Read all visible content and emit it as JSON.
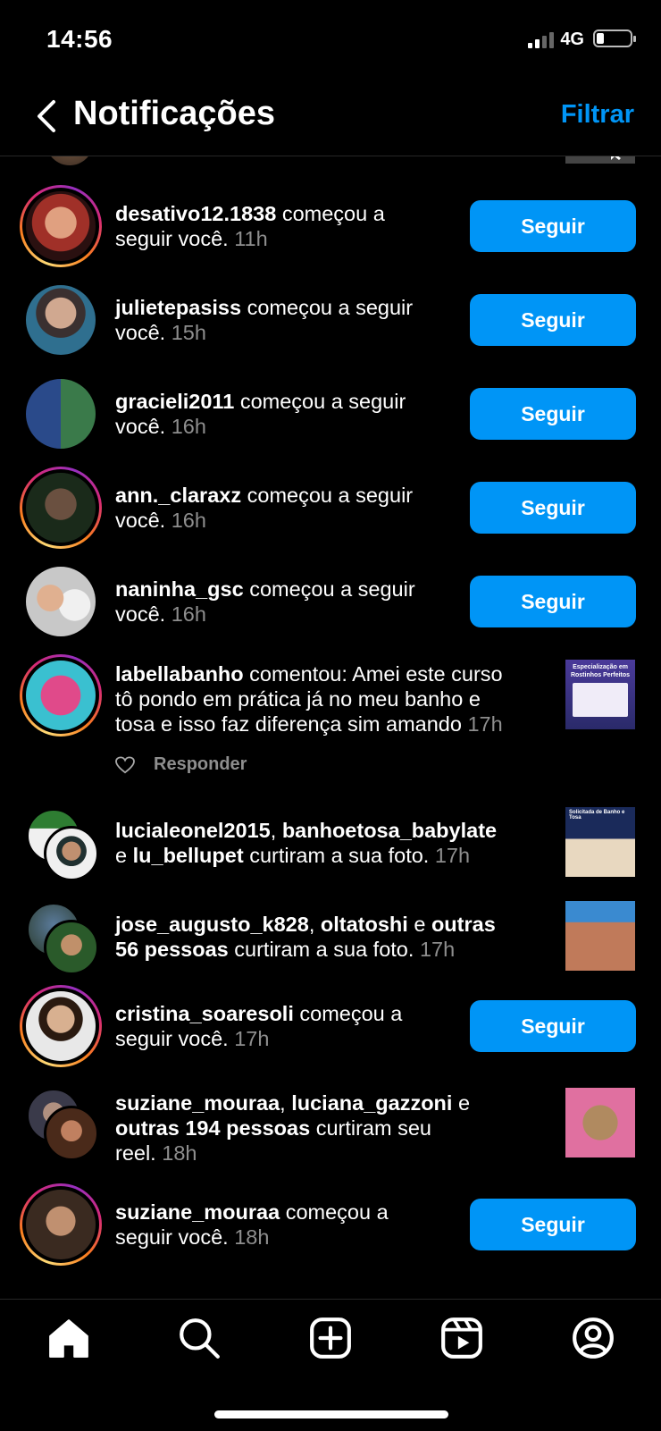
{
  "status_bar": {
    "time": "14:56",
    "network": "4G"
  },
  "header": {
    "title": "Notificações",
    "filter_label": "Filtrar"
  },
  "notifications": [
    {
      "user": "desativo12.1838",
      "action": "começou a",
      "action2": "seguir você.",
      "time": "11h",
      "button": "Seguir"
    },
    {
      "user": "julietepasiss",
      "action": "começou a seguir",
      "action2": "você.",
      "time": "15h",
      "button": "Seguir"
    },
    {
      "user": "gracieli2011",
      "action": "começou a seguir",
      "action2": "você.",
      "time": "16h",
      "button": "Seguir"
    },
    {
      "user": "ann._claraxz",
      "action": "começou a seguir",
      "action2": "você.",
      "time": "16h",
      "button": "Seguir"
    },
    {
      "user": "naninha_gsc",
      "action": "começou a seguir",
      "action2": "você.",
      "time": "16h",
      "button": "Seguir"
    },
    {
      "user": "labellabanho",
      "line1": "comentou: Amei este curso",
      "line2": "tô pondo em prática já no meu banho e",
      "line3": "tosa e isso faz diferença sim amando",
      "time": "17h",
      "reply": "Responder"
    },
    {
      "user": "lucialeonel2015",
      "sep": ",",
      "user2": "banhoetosa_babylate",
      "and": "e",
      "user3": "lu_bellupet",
      "action": "curtiram a sua foto.",
      "time": "17h"
    },
    {
      "user": "jose_augusto_k828",
      "sep": ",",
      "user2": "oltatoshi",
      "and": "e",
      "others": "outras",
      "others2": "56 pessoas",
      "action": "curtiram a sua foto.",
      "time": "17h"
    },
    {
      "user": "cristina_soaresoli",
      "action": "começou a",
      "action2": "seguir você.",
      "time": "17h",
      "button": "Seguir"
    },
    {
      "user": "suziane_mouraa",
      "sep": ",",
      "user2": "luciana_gazzoni",
      "and": "e",
      "others": "outras 194 pessoas",
      "action": "curtiram seu",
      "action2": "reel.",
      "time": "18h"
    },
    {
      "user": "suziane_mouraa",
      "action": "começou a",
      "action2": "seguir você.",
      "time": "18h",
      "button": "Seguir"
    }
  ],
  "thumbs": {
    "labella": {
      "line1": "Especialização em",
      "line2": "Rostinhos Perfeitos"
    },
    "lucia": {
      "line1": "Solicitada de Banho e Tosa"
    }
  },
  "colors": {
    "accent": "#0095f6",
    "muted": "#8e8e8e",
    "background": "#000000"
  },
  "tabbar": {
    "icons": [
      "home-icon",
      "search-icon",
      "new-post-icon",
      "reels-icon",
      "profile-icon"
    ]
  }
}
